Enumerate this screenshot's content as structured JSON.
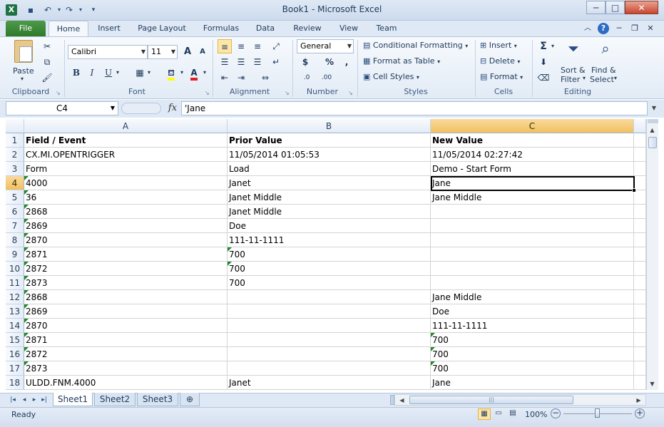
{
  "window": {
    "title": "Book1  -  Microsoft Excel",
    "app_icon": "X",
    "controls": {
      "minimize": "─",
      "maximize": "□",
      "close": "✕"
    }
  },
  "ribbon_tabs": [
    "File",
    "Home",
    "Insert",
    "Page Layout",
    "Formulas",
    "Data",
    "Review",
    "View",
    "Team"
  ],
  "ribbon": {
    "clipboard": {
      "label": "Clipboard",
      "paste": "Paste"
    },
    "font": {
      "label": "Font",
      "name": "Calibri",
      "size": "11",
      "bold": "B",
      "italic": "I",
      "underline": "U",
      "grow": "A",
      "shrink": "A",
      "font_color": "A"
    },
    "alignment": {
      "label": "Alignment"
    },
    "number": {
      "label": "Number",
      "format": "General",
      "currency": "$",
      "percent": "%",
      "comma": ",",
      "inc_decimal": ".0",
      "dec_decimal": ".00"
    },
    "styles": {
      "label": "Styles",
      "conditional": "Conditional Formatting",
      "format_table": "Format as Table",
      "cell_styles": "Cell Styles"
    },
    "cells": {
      "label": "Cells",
      "insert": "Insert",
      "delete": "Delete",
      "format": "Format"
    },
    "editing": {
      "label": "Editing",
      "sum": "Σ",
      "sort_filter_1": "Sort &",
      "sort_filter_2": "Filter",
      "find_select_1": "Find &",
      "find_select_2": "Select"
    }
  },
  "formula_bar": {
    "name_box": "C4",
    "fx": "fx",
    "content": "'Jane"
  },
  "grid": {
    "columns": [
      "A",
      "B",
      "C"
    ],
    "selected_column": "C",
    "selected_row": 4,
    "rows": [
      {
        "num": "1",
        "a": "Field / Event",
        "b": "Prior Value",
        "c": "New Value"
      },
      {
        "num": "2",
        "a": "CX.MI.OPENTRIGGER",
        "b": "11/05/2014 01:05:53",
        "c": "11/05/2014 02:27:42"
      },
      {
        "num": "3",
        "a": " Form",
        "b": "Load",
        "c": "Demo - Start Form"
      },
      {
        "num": "4",
        "a": "4000",
        "b": "Janet",
        "c": "Jane"
      },
      {
        "num": "5",
        "a": "36",
        "b": "Janet Middle",
        "c": "Jane Middle"
      },
      {
        "num": "6",
        "a": "2868",
        "b": "Janet Middle",
        "c": ""
      },
      {
        "num": "7",
        "a": "2869",
        "b": "Doe",
        "c": ""
      },
      {
        "num": "8",
        "a": "2870",
        "b": "111-11-1111",
        "c": ""
      },
      {
        "num": "9",
        "a": "2871",
        "b": "700",
        "c": ""
      },
      {
        "num": "10",
        "a": "2872",
        "b": "700",
        "c": ""
      },
      {
        "num": "11",
        "a": "2873",
        "b": "700",
        "c": ""
      },
      {
        "num": "12",
        "a": "2868",
        "b": "",
        "c": "Jane Middle"
      },
      {
        "num": "13",
        "a": "2869",
        "b": "",
        "c": "Doe"
      },
      {
        "num": "14",
        "a": "2870",
        "b": "",
        "c": "111-11-1111"
      },
      {
        "num": "15",
        "a": "2871",
        "b": "",
        "c": "700"
      },
      {
        "num": "16",
        "a": "2872",
        "b": "",
        "c": "700"
      },
      {
        "num": "17",
        "a": "2873",
        "b": "",
        "c": "700"
      },
      {
        "num": "18",
        "a": "ULDD.FNM.4000",
        "b": "Janet",
        "c": "Jane"
      }
    ]
  },
  "sheets": [
    "Sheet1",
    "Sheet2",
    "Sheet3"
  ],
  "active_sheet": "Sheet1",
  "status": {
    "ready": "Ready",
    "zoom": "100%"
  },
  "colors": {
    "file_tab": "#2c7a2a",
    "selected_header": "#f1c15f",
    "error_indicator": "#1f8a2a"
  }
}
